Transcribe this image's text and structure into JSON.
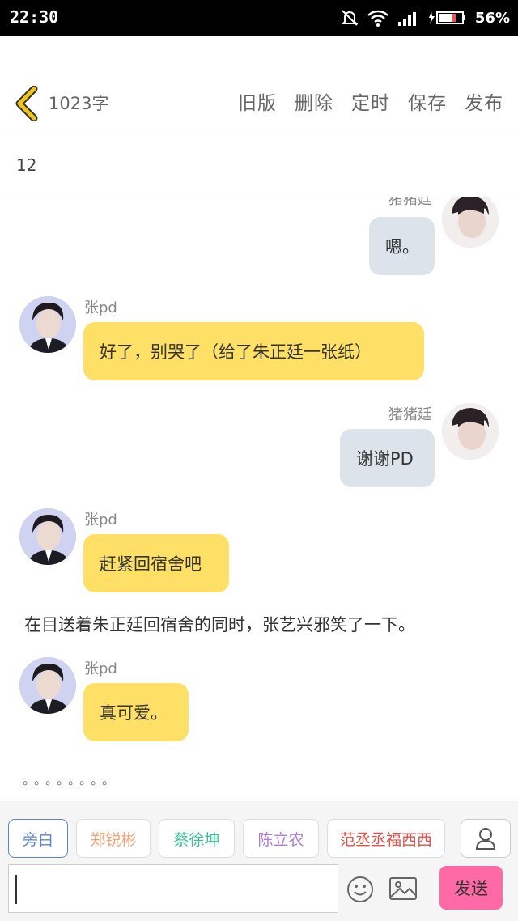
{
  "status_bar": {
    "time": "22:30",
    "battery_percent": "56%"
  },
  "header": {
    "word_count": "1023字",
    "actions": [
      "旧版",
      "删除",
      "定时",
      "保存",
      "发布"
    ]
  },
  "chapter_title": "12",
  "messages": [
    {
      "sender": "猪猪廷",
      "text": "嗯。",
      "side": "right"
    },
    {
      "sender": "张pd",
      "text": "好了，别哭了（给了朱正廷一张纸）",
      "side": "left"
    },
    {
      "sender": "猪猪廷",
      "text": "谢谢PD",
      "side": "right"
    },
    {
      "sender": "张pd",
      "text": "赶紧回宿舍吧",
      "side": "left"
    },
    {
      "narration": "在目送着朱正廷回宿舍的同时，张艺兴邪笑了一下。"
    },
    {
      "sender": "张pd",
      "text": "真可爱。",
      "side": "left"
    },
    {
      "ellipsis": "。。。。。。。。"
    }
  ],
  "roles": [
    {
      "label": "旁白",
      "color": "#5a86c8"
    },
    {
      "label": "郑锐彬",
      "color": "#f2a57a"
    },
    {
      "label": "蔡徐坤",
      "color": "#3fbf9a"
    },
    {
      "label": "陈立农",
      "color": "#b07ad6"
    },
    {
      "label": "范丞丞福西西",
      "color": "#e2524a"
    }
  ],
  "composer": {
    "send_label": "发送"
  },
  "colors": {
    "accent_yellow": "#ffe066",
    "self_bubble": "#dde3ea",
    "send_button": "#ff6aa6",
    "back_arrow": "#f0c419"
  }
}
